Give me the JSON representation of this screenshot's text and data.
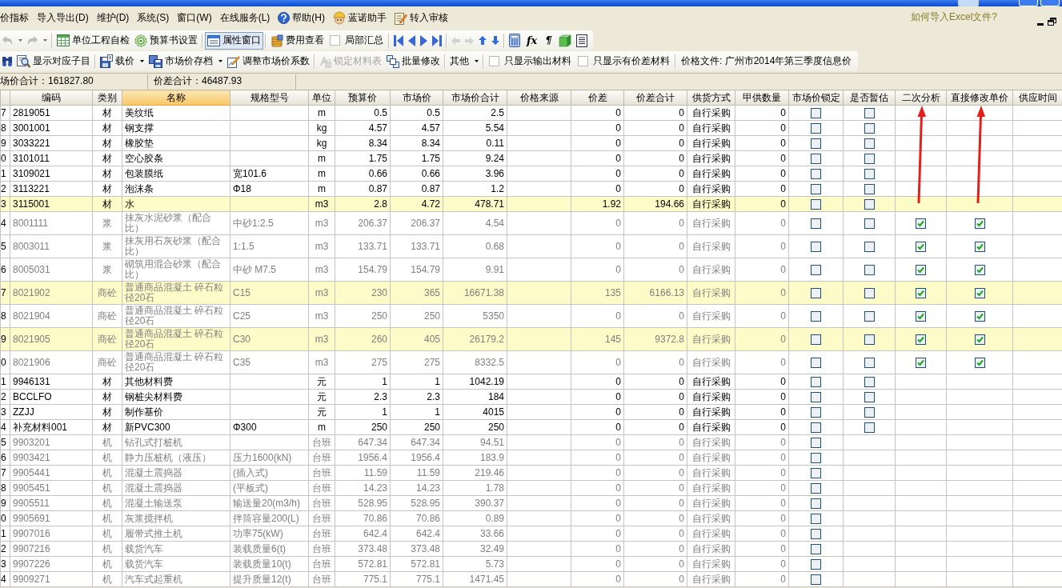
{
  "menu": [
    {
      "label": "价指标"
    },
    {
      "label": "导入导出(D)"
    },
    {
      "label": "维护(D)"
    },
    {
      "label": "系统(S)"
    },
    {
      "label": "窗口(W)"
    },
    {
      "label": "在线服务(L)"
    },
    {
      "label": "帮助(H)"
    },
    {
      "label": "蓝诺助手"
    },
    {
      "label": "转入审核"
    }
  ],
  "help_link": "如何导入Excel文件?",
  "toolbars": [
    {
      "groups": [
        {
          "items": [
            {
              "kind": "button",
              "pressed": false,
              "disabled": true,
              "dropdown": true
            },
            {
              "kind": "button",
              "pressed": false,
              "disabled": true,
              "dropdown": true
            }
          ]
        },
        {
          "items": [
            {
              "kind": "button",
              "label": "单位工程自检",
              "pressed": false,
              "disabled": false,
              "dropdown": false
            },
            {
              "kind": "button",
              "label": "预算书设置",
              "pressed": false,
              "disabled": false,
              "dropdown": false
            }
          ]
        },
        {
          "items": [
            {
              "kind": "button",
              "label": "属性窗口",
              "pressed": true,
              "disabled": false,
              "dropdown": false
            }
          ]
        },
        {
          "items": [
            {
              "kind": "button",
              "label": "费用查看",
              "pressed": false,
              "disabled": false,
              "dropdown": false
            },
            {
              "kind": "checkbox",
              "label": "局部汇总",
              "checked": false
            }
          ]
        },
        {
          "items": [
            {
              "kind": "button",
              "pressed": false,
              "disabled": false,
              "dropdown": false
            },
            {
              "kind": "button",
              "pressed": false,
              "disabled": false,
              "dropdown": false
            },
            {
              "kind": "button",
              "pressed": false,
              "disabled": false,
              "dropdown": false
            },
            {
              "kind": "button",
              "pressed": false,
              "disabled": false,
              "dropdown": false
            }
          ]
        },
        {
          "items": [
            {
              "kind": "button",
              "pressed": false,
              "disabled": true,
              "dropdown": false
            },
            {
              "kind": "button",
              "pressed": false,
              "disabled": true,
              "dropdown": false
            },
            {
              "kind": "button",
              "pressed": false,
              "disabled": false,
              "dropdown": false
            },
            {
              "kind": "button",
              "pressed": false,
              "disabled": false,
              "dropdown": false
            }
          ]
        },
        {
          "items": [
            {
              "kind": "button",
              "pressed": false,
              "disabled": false,
              "dropdown": false
            },
            {
              "kind": "glyph",
              "label": "fx"
            },
            {
              "kind": "glyph",
              "label": "¶"
            },
            {
              "kind": "button",
              "pressed": false,
              "disabled": false,
              "dropdown": false
            },
            {
              "kind": "button",
              "pressed": false,
              "disabled": false,
              "dropdown": false
            }
          ]
        }
      ]
    },
    {
      "groups": [
        {
          "items": [
            {
              "kind": "button",
              "pressed": false,
              "disabled": false,
              "dropdown": false
            },
            {
              "kind": "button",
              "label": "显示对应子目",
              "pressed": false,
              "disabled": false,
              "dropdown": false
            }
          ]
        },
        {
          "items": [
            {
              "kind": "button",
              "label": "载价",
              "pressed": false,
              "disabled": false,
              "dropdown": true
            },
            {
              "kind": "button",
              "label": "市场价存档",
              "pressed": false,
              "disabled": false,
              "dropdown": true
            },
            {
              "kind": "button",
              "label": "调整市场价系数",
              "pressed": false,
              "disabled": false,
              "dropdown": false
            }
          ]
        },
        {
          "items": [
            {
              "kind": "button",
              "label": "锁定材料表",
              "pressed": false,
              "disabled": true,
              "dropdown": false
            },
            {
              "kind": "button",
              "label": "批量修改",
              "pressed": false,
              "disabled": false,
              "dropdown": false
            }
          ]
        },
        {
          "items": [
            {
              "kind": "button",
              "label": "其他",
              "pressed": false,
              "disabled": false,
              "dropdown": true
            }
          ]
        },
        {
          "items": [
            {
              "kind": "checkbox",
              "label": "只显示输出材料",
              "checked": false
            },
            {
              "kind": "checkbox",
              "label": "只显示有价差材料",
              "checked": false
            }
          ]
        },
        {
          "items": [
            {
              "kind": "text",
              "label": "价格文件: 广州市2014年第三季度信息价"
            }
          ]
        }
      ]
    }
  ],
  "totals": [
    "场价合计：161827.80",
    "价差合计：46487.93"
  ],
  "table": {
    "columns": [
      {
        "label": "编码",
        "selected": false,
        "arrow": false
      },
      {
        "label": "类别",
        "selected": false,
        "arrow": false
      },
      {
        "label": "名称",
        "selected": true,
        "arrow": false
      },
      {
        "label": "规格型号",
        "selected": false,
        "arrow": false
      },
      {
        "label": "单位",
        "selected": false,
        "arrow": false
      },
      {
        "label": "预算价",
        "selected": false,
        "arrow": false
      },
      {
        "label": "市场价",
        "selected": false,
        "arrow": false
      },
      {
        "label": "市场价合计",
        "selected": false,
        "arrow": false
      },
      {
        "label": "价格来源",
        "selected": false,
        "arrow": false
      },
      {
        "label": "价差",
        "selected": false,
        "arrow": false
      },
      {
        "label": "价差合计",
        "selected": false,
        "arrow": false
      },
      {
        "label": "供货方式",
        "selected": false,
        "arrow": false
      },
      {
        "label": "甲供数量",
        "selected": false,
        "arrow": false
      },
      {
        "label": "市场价锁定",
        "selected": false,
        "arrow": false
      },
      {
        "label": "是否暂估",
        "selected": false,
        "arrow": false
      },
      {
        "label": "二次分析",
        "selected": false,
        "arrow": true
      },
      {
        "label": "直接修改单价",
        "selected": false,
        "arrow": true
      },
      {
        "label": "供应时间",
        "selected": false,
        "arrow": false
      }
    ],
    "rows": [
      {
        "number": "7",
        "code": "2819051",
        "category": "材",
        "name": "美纹纸",
        "unit": "m",
        "budget_price": "0.5",
        "market_price": "0.5",
        "market_total": "2.5",
        "price_diff": "0",
        "diff_total": "0",
        "supply_mode": "自行采购",
        "supplied_qty": "0",
        "locked": false,
        "provisional": false,
        "highlighted": false,
        "dimmed": false
      },
      {
        "number": "8",
        "code": "3001001",
        "category": "材",
        "name": "钢支撑",
        "unit": "kg",
        "budget_price": "4.57",
        "market_price": "4.57",
        "market_total": "5.54",
        "price_diff": "0",
        "diff_total": "0",
        "supply_mode": "自行采购",
        "supplied_qty": "0",
        "locked": false,
        "provisional": false,
        "highlighted": false,
        "dimmed": false
      },
      {
        "number": "9",
        "code": "3033221",
        "category": "材",
        "name": "橡胶垫",
        "unit": "kg",
        "budget_price": "8.34",
        "market_price": "8.34",
        "market_total": "0.11",
        "price_diff": "0",
        "diff_total": "0",
        "supply_mode": "自行采购",
        "supplied_qty": "0",
        "locked": false,
        "provisional": false,
        "highlighted": false,
        "dimmed": false
      },
      {
        "number": "0",
        "code": "3101011",
        "category": "材",
        "name": "空心胶条",
        "unit": "m",
        "budget_price": "1.75",
        "market_price": "1.75",
        "market_total": "9.24",
        "price_diff": "0",
        "diff_total": "0",
        "supply_mode": "自行采购",
        "supplied_qty": "0",
        "locked": false,
        "provisional": false,
        "highlighted": false,
        "dimmed": false
      },
      {
        "number": "1",
        "code": "3109021",
        "category": "材",
        "name": "包装膜纸",
        "spec": "宽101.6",
        "unit": "m",
        "budget_price": "0.66",
        "market_price": "0.66",
        "market_total": "3.96",
        "price_diff": "0",
        "diff_total": "0",
        "supply_mode": "自行采购",
        "supplied_qty": "0",
        "locked": false,
        "provisional": false,
        "highlighted": false,
        "dimmed": false
      },
      {
        "number": "2",
        "code": "3113221",
        "category": "材",
        "name": "泡沫条",
        "spec": "Φ18",
        "unit": "m",
        "budget_price": "0.87",
        "market_price": "0.87",
        "market_total": "1.2",
        "price_diff": "0",
        "diff_total": "0",
        "supply_mode": "自行采购",
        "supplied_qty": "0",
        "locked": false,
        "provisional": false,
        "highlighted": false,
        "dimmed": false
      },
      {
        "number": "3",
        "code": "3115001",
        "category": "材",
        "name": "水",
        "unit": "m3",
        "budget_price": "2.8",
        "market_price": "4.72",
        "market_total": "478.71",
        "price_diff": "1.92",
        "diff_total": "194.66",
        "supply_mode": "自行采购",
        "supplied_qty": "0",
        "locked": false,
        "provisional": false,
        "highlighted": true,
        "dimmed": false
      },
      {
        "number": "4",
        "code": "8001111",
        "category": "浆",
        "name": "抹灰水泥砂浆（配合比）",
        "spec": "中砂1:2.5",
        "unit": "m3",
        "budget_price": "206.37",
        "market_price": "206.37",
        "market_total": "4.54",
        "price_diff": "0",
        "diff_total": "0",
        "supply_mode": "自行采购",
        "supplied_qty": "0",
        "locked": false,
        "provisional": false,
        "secondary_analysis": true,
        "direct_edit": true,
        "highlighted": false,
        "dimmed": true
      },
      {
        "number": "5",
        "code": "8003011",
        "category": "浆",
        "name": "抹灰用石灰砂浆（配合比）",
        "spec": "1:1.5",
        "unit": "m3",
        "budget_price": "133.71",
        "market_price": "133.71",
        "market_total": "0.68",
        "price_diff": "0",
        "diff_total": "0",
        "supply_mode": "自行采购",
        "supplied_qty": "0",
        "locked": false,
        "provisional": false,
        "secondary_analysis": true,
        "direct_edit": true,
        "highlighted": false,
        "dimmed": true
      },
      {
        "number": "6",
        "code": "8005031",
        "category": "浆",
        "name": "砌筑用混合砂浆（配合比）",
        "spec": "中砂 M7.5",
        "unit": "m3",
        "budget_price": "154.79",
        "market_price": "154.79",
        "market_total": "9.91",
        "price_diff": "0",
        "diff_total": "0",
        "supply_mode": "自行采购",
        "supplied_qty": "0",
        "locked": false,
        "provisional": false,
        "secondary_analysis": true,
        "direct_edit": true,
        "highlighted": false,
        "dimmed": true
      },
      {
        "number": "7",
        "code": "8021902",
        "category": "商砼",
        "name": "普通商品混凝土 碎石粒径20石",
        "spec": "C15",
        "unit": "m3",
        "budget_price": "230",
        "market_price": "365",
        "market_total": "16671.38",
        "price_diff": "135",
        "diff_total": "6166.13",
        "supply_mode": "自行采购",
        "supplied_qty": "0",
        "locked": false,
        "provisional": false,
        "secondary_analysis": true,
        "direct_edit": true,
        "highlighted": true,
        "dimmed": true
      },
      {
        "number": "8",
        "code": "8021904",
        "category": "商砼",
        "name": "普通商品混凝土 碎石粒径20石",
        "spec": "C25",
        "unit": "m3",
        "budget_price": "250",
        "market_price": "250",
        "market_total": "5350",
        "price_diff": "0",
        "diff_total": "0",
        "supply_mode": "自行采购",
        "supplied_qty": "0",
        "locked": false,
        "provisional": false,
        "secondary_analysis": true,
        "direct_edit": true,
        "highlighted": false,
        "dimmed": true
      },
      {
        "number": "9",
        "code": "8021905",
        "category": "商砼",
        "name": "普通商品混凝土 碎石粒径20石",
        "spec": "C30",
        "unit": "m3",
        "budget_price": "260",
        "market_price": "405",
        "market_total": "26179.2",
        "price_diff": "145",
        "diff_total": "9372.8",
        "supply_mode": "自行采购",
        "supplied_qty": "0",
        "locked": false,
        "provisional": false,
        "secondary_analysis": true,
        "direct_edit": true,
        "highlighted": true,
        "dimmed": true
      },
      {
        "number": "0",
        "code": "8021906",
        "category": "商砼",
        "name": "普通商品混凝土 碎石粒径20石",
        "spec": "C35",
        "unit": "m3",
        "budget_price": "275",
        "market_price": "275",
        "market_total": "8332.5",
        "price_diff": "0",
        "diff_total": "0",
        "supply_mode": "自行采购",
        "supplied_qty": "0",
        "locked": false,
        "provisional": false,
        "secondary_analysis": true,
        "direct_edit": true,
        "highlighted": false,
        "dimmed": true
      },
      {
        "number": "1",
        "code": "9946131",
        "category": "材",
        "name": "其他材料费",
        "unit": "元",
        "budget_price": "1",
        "market_price": "1",
        "market_total": "1042.19",
        "price_diff": "0",
        "diff_total": "0",
        "supply_mode": "自行采购",
        "supplied_qty": "0",
        "locked": false,
        "provisional": false,
        "highlighted": false,
        "dimmed": false
      },
      {
        "number": "2",
        "code": "BCCLFO",
        "category": "材",
        "name": "钢桩尖材料费",
        "unit": "元",
        "budget_price": "2.3",
        "market_price": "2.3",
        "market_total": "184",
        "price_diff": "0",
        "diff_total": "0",
        "supply_mode": "自行采购",
        "supplied_qty": "0",
        "locked": false,
        "provisional": false,
        "highlighted": false,
        "dimmed": false
      },
      {
        "number": "3",
        "code": "ZZJJ",
        "category": "材",
        "name": "制作基价",
        "unit": "元",
        "budget_price": "1",
        "market_price": "1",
        "market_total": "4015",
        "price_diff": "0",
        "diff_total": "0",
        "supply_mode": "自行采购",
        "supplied_qty": "0",
        "locked": false,
        "provisional": false,
        "highlighted": false,
        "dimmed": false
      },
      {
        "number": "4",
        "code": "补充材料001",
        "category": "材",
        "name": "新PVC300",
        "spec": "Φ300",
        "unit": "m",
        "budget_price": "250",
        "market_price": "250",
        "market_total": "250",
        "price_diff": "0",
        "diff_total": "0",
        "supply_mode": "自行采购",
        "supplied_qty": "0",
        "locked": false,
        "provisional": false,
        "highlighted": false,
        "dimmed": false
      },
      {
        "number": "5",
        "code": "9903201",
        "category": "机",
        "name": "钻孔式打桩机",
        "unit": "台班",
        "budget_price": "647.34",
        "market_price": "647.34",
        "market_total": "94.51",
        "price_diff": "0",
        "diff_total": "0",
        "supply_mode": "自行采购",
        "supplied_qty": "0",
        "locked": false,
        "highlighted": false,
        "dimmed": true
      },
      {
        "number": "6",
        "code": "9903421",
        "category": "机",
        "name": "静力压桩机（液压）",
        "spec": "压力1600(kN)",
        "unit": "台班",
        "budget_price": "1956.4",
        "market_price": "1956.4",
        "market_total": "183.9",
        "price_diff": "0",
        "diff_total": "0",
        "supply_mode": "自行采购",
        "supplied_qty": "0",
        "locked": false,
        "highlighted": false,
        "dimmed": true
      },
      {
        "number": "7",
        "code": "9905441",
        "category": "机",
        "name": "混凝土震捣器",
        "spec": "(插入式)",
        "unit": "台班",
        "budget_price": "11.59",
        "market_price": "11.59",
        "market_total": "219.46",
        "price_diff": "0",
        "diff_total": "0",
        "supply_mode": "自行采购",
        "supplied_qty": "0",
        "locked": false,
        "highlighted": false,
        "dimmed": true
      },
      {
        "number": "8",
        "code": "9905451",
        "category": "机",
        "name": "混凝土震捣器",
        "spec": "(平板式)",
        "unit": "台班",
        "budget_price": "14.23",
        "market_price": "14.23",
        "market_total": "1.78",
        "price_diff": "0",
        "diff_total": "0",
        "supply_mode": "自行采购",
        "supplied_qty": "0",
        "locked": false,
        "highlighted": false,
        "dimmed": true
      },
      {
        "number": "9",
        "code": "9905511",
        "category": "机",
        "name": "混凝土输送泵",
        "spec": "输送量20(m3/h)",
        "unit": "台班",
        "budget_price": "528.95",
        "market_price": "528.95",
        "market_total": "390.37",
        "price_diff": "0",
        "diff_total": "0",
        "supply_mode": "自行采购",
        "supplied_qty": "0",
        "locked": false,
        "highlighted": false,
        "dimmed": true
      },
      {
        "number": "0",
        "code": "9905691",
        "category": "机",
        "name": "灰浆搅拌机",
        "spec": "拌筒容量200(L)",
        "unit": "台班",
        "budget_price": "70.86",
        "market_price": "70.86",
        "market_total": "0.89",
        "price_diff": "0",
        "diff_total": "0",
        "supply_mode": "自行采购",
        "supplied_qty": "0",
        "locked": false,
        "highlighted": false,
        "dimmed": true
      },
      {
        "number": "1",
        "code": "9907016",
        "category": "机",
        "name": "履带式推土机",
        "spec": "功率75(kW)",
        "unit": "台班",
        "budget_price": "642.4",
        "market_price": "642.4",
        "market_total": "33.66",
        "price_diff": "0",
        "diff_total": "0",
        "supply_mode": "自行采购",
        "supplied_qty": "0",
        "locked": false,
        "highlighted": false,
        "dimmed": true
      },
      {
        "number": "2",
        "code": "9907216",
        "category": "机",
        "name": "载货汽车",
        "spec": "装载质量6(t)",
        "unit": "台班",
        "budget_price": "373.48",
        "market_price": "373.48",
        "market_total": "32.49",
        "price_diff": "0",
        "diff_total": "0",
        "supply_mode": "自行采购",
        "supplied_qty": "0",
        "locked": false,
        "highlighted": false,
        "dimmed": true
      },
      {
        "number": "3",
        "code": "9907226",
        "category": "机",
        "name": "载货汽车",
        "spec": "装载质量10(t)",
        "unit": "台班",
        "budget_price": "572.81",
        "market_price": "572.81",
        "market_total": "5.73",
        "price_diff": "0",
        "diff_total": "0",
        "supply_mode": "自行采购",
        "supplied_qty": "0",
        "locked": false,
        "highlighted": false,
        "dimmed": true
      },
      {
        "number": "4",
        "code": "9909271",
        "category": "机",
        "name": "汽车式起重机",
        "spec": "提升质量12(t)",
        "unit": "台班",
        "budget_price": "775.1",
        "market_price": "775.1",
        "market_total": "1471.45",
        "price_diff": "0",
        "diff_total": "0",
        "supply_mode": "自行采购",
        "supplied_qty": "0",
        "locked": false,
        "highlighted": false,
        "dimmed": true
      }
    ]
  }
}
